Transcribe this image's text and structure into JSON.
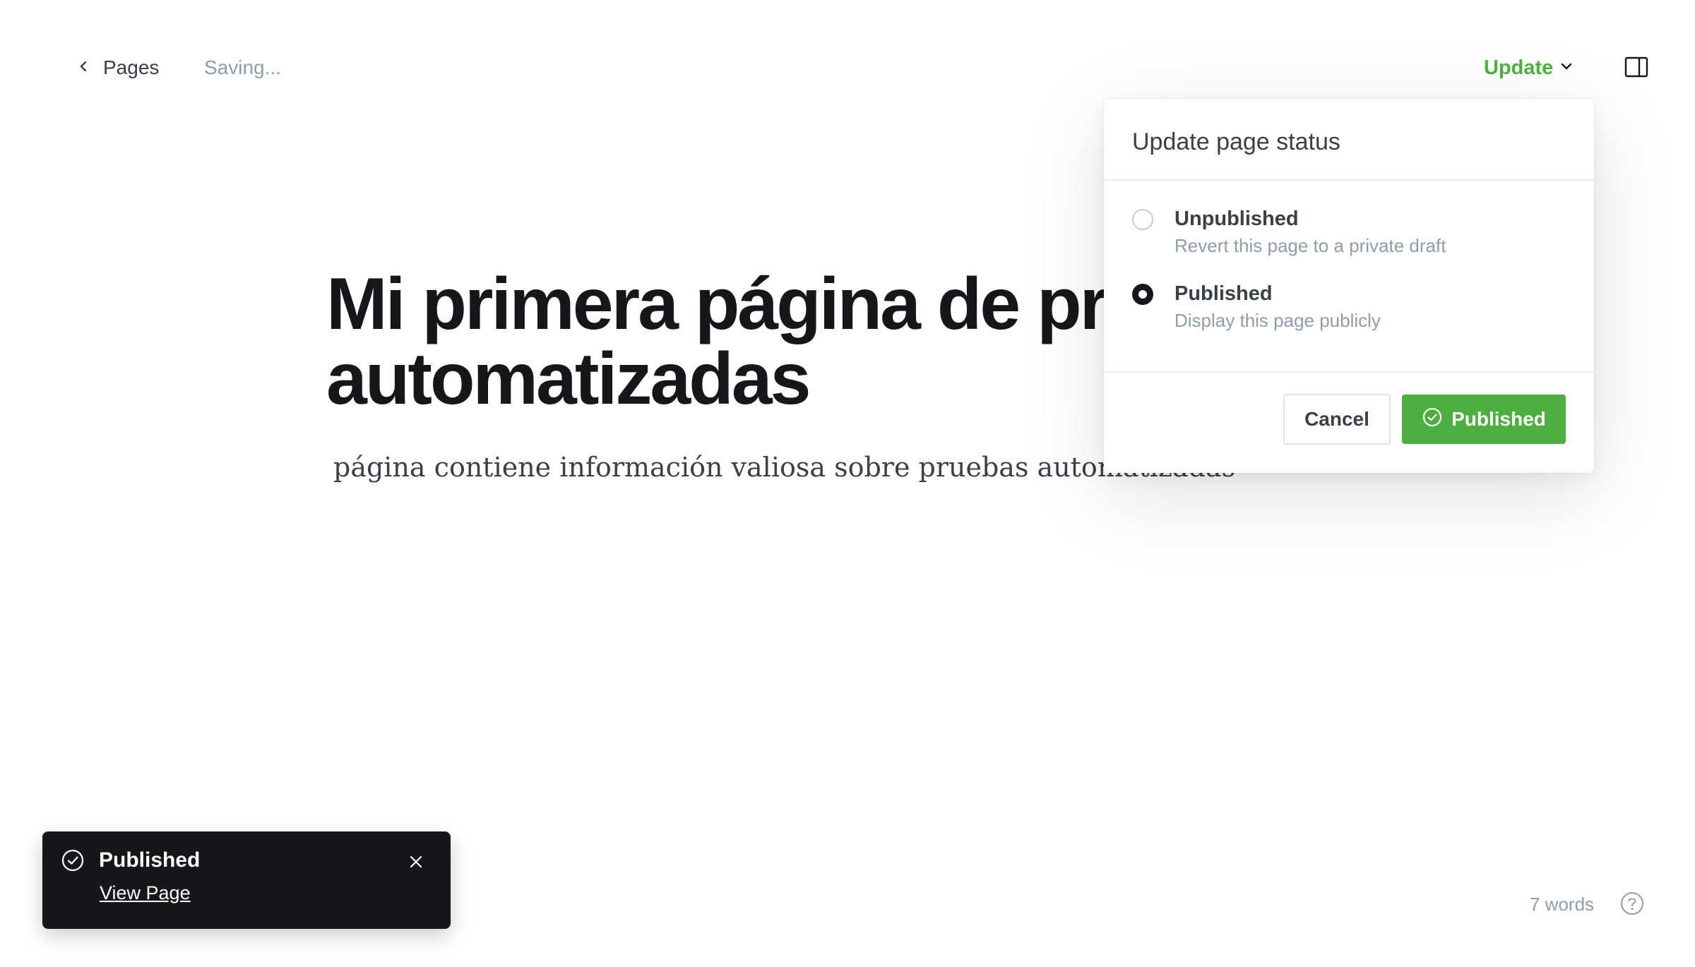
{
  "header": {
    "back_label": "Pages",
    "saving_status": "Saving...",
    "update_label": "Update"
  },
  "editor": {
    "title": "Mi primera página de prue automatizadas",
    "title_line1": "Mi primera página de prue",
    "title_line2": "automatizadas",
    "body": "página contiene información valiosa sobre pruebas automatizadas"
  },
  "popover": {
    "title": "Update page status",
    "options": [
      {
        "label": "Unpublished",
        "description": "Revert this page to a private draft",
        "selected": false
      },
      {
        "label": "Published",
        "description": "Display this page publicly",
        "selected": true
      }
    ],
    "cancel_label": "Cancel",
    "confirm_label": "Published"
  },
  "toast": {
    "title": "Published",
    "link_label": "View Page"
  },
  "footer": {
    "word_count": "7 words"
  },
  "colors": {
    "accent_green": "#4cb43d",
    "button_green": "#4caf3f",
    "toast_bg": "#15171a"
  },
  "icons": {
    "back": "chevron-left-icon",
    "update": "chevron-down-icon",
    "sidebar": "sidebar-toggle-icon",
    "check": "check-circle-icon",
    "close": "close-icon",
    "help": "question-circle-icon"
  }
}
